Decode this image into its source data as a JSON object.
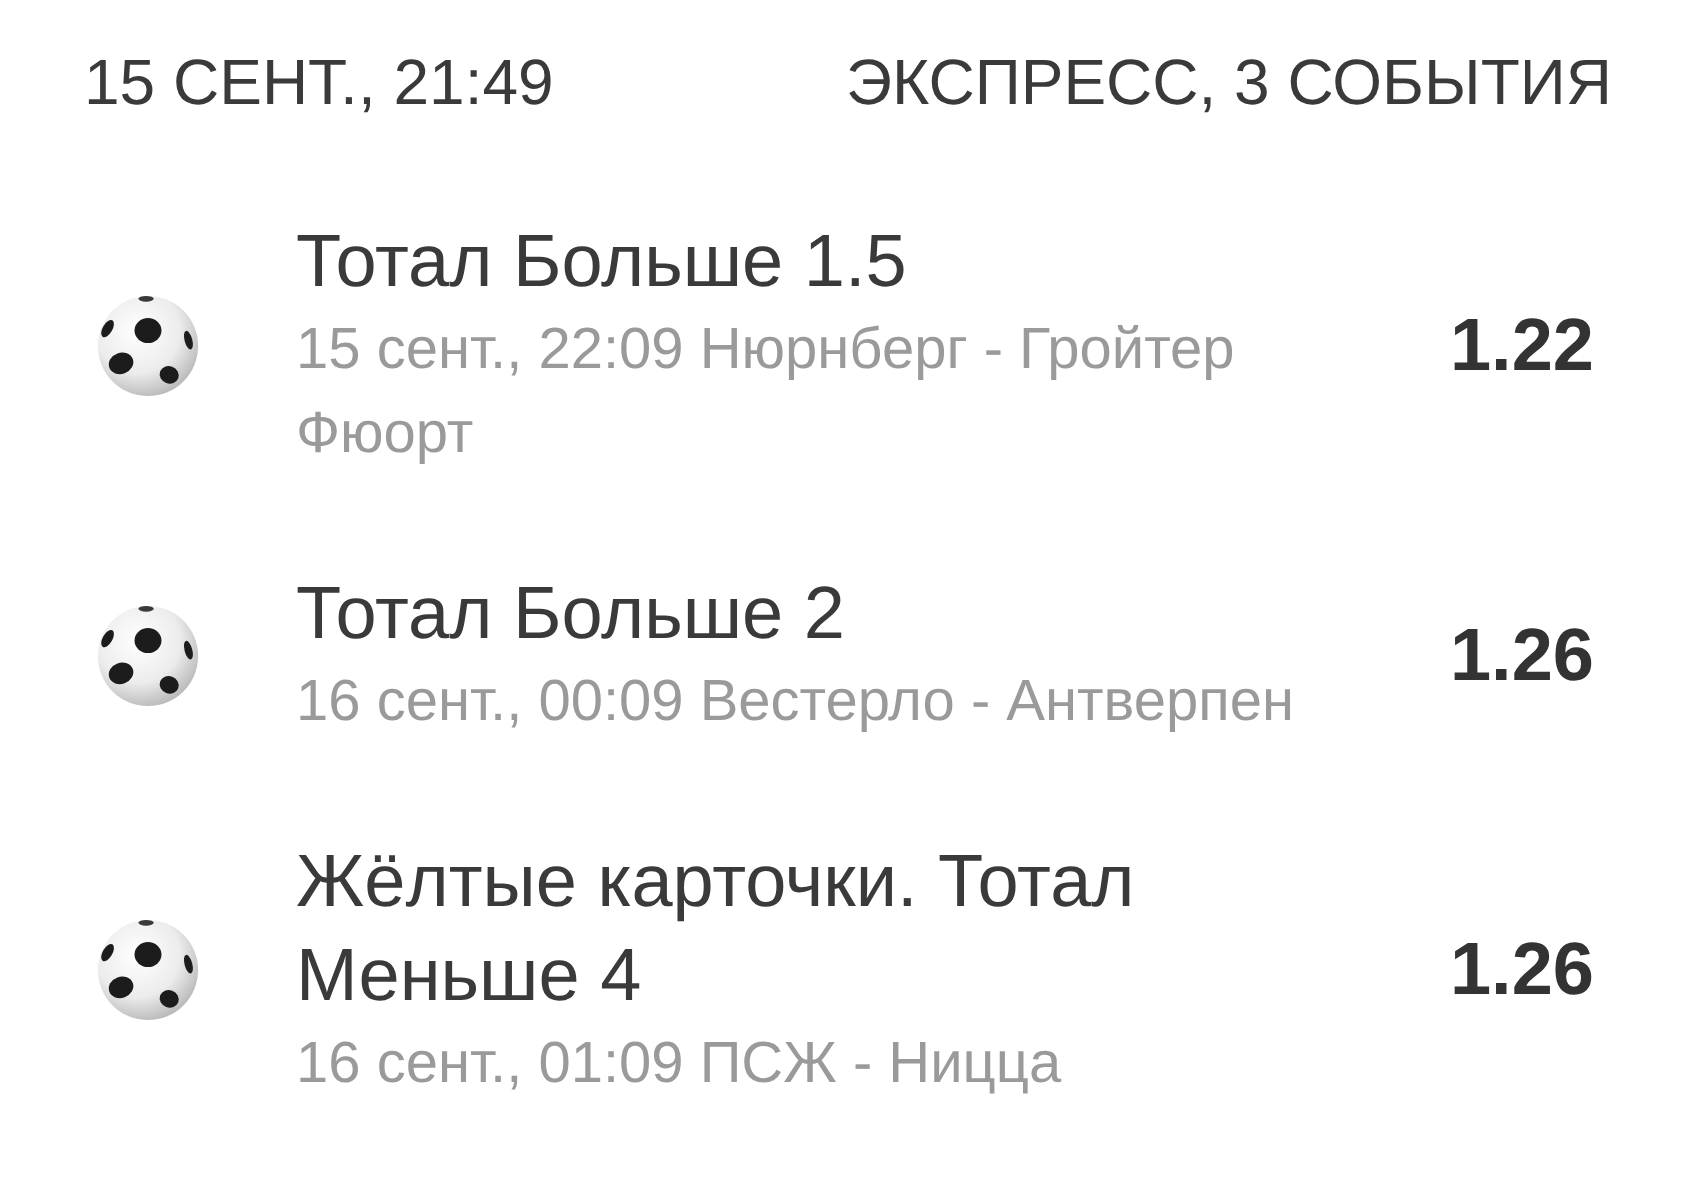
{
  "header": {
    "date": "15 СЕНТ., 21:49",
    "title": "ЭКСПРЕСС, 3 СОБЫТИЯ"
  },
  "events": [
    {
      "market": "Тотал Больше 1.5",
      "details": "15 сент., 22:09 Нюрнберг - Гройтер Фюорт",
      "odds": "1.22"
    },
    {
      "market": "Тотал Больше 2",
      "details": "16 сент., 00:09 Вестерло - Антверпен",
      "odds": "1.26"
    },
    {
      "market": "Жёлтые карточки. Тотал Меньше 4",
      "details": "16 сент., 01:09 ПСЖ - Ницца",
      "odds": "1.26"
    }
  ]
}
